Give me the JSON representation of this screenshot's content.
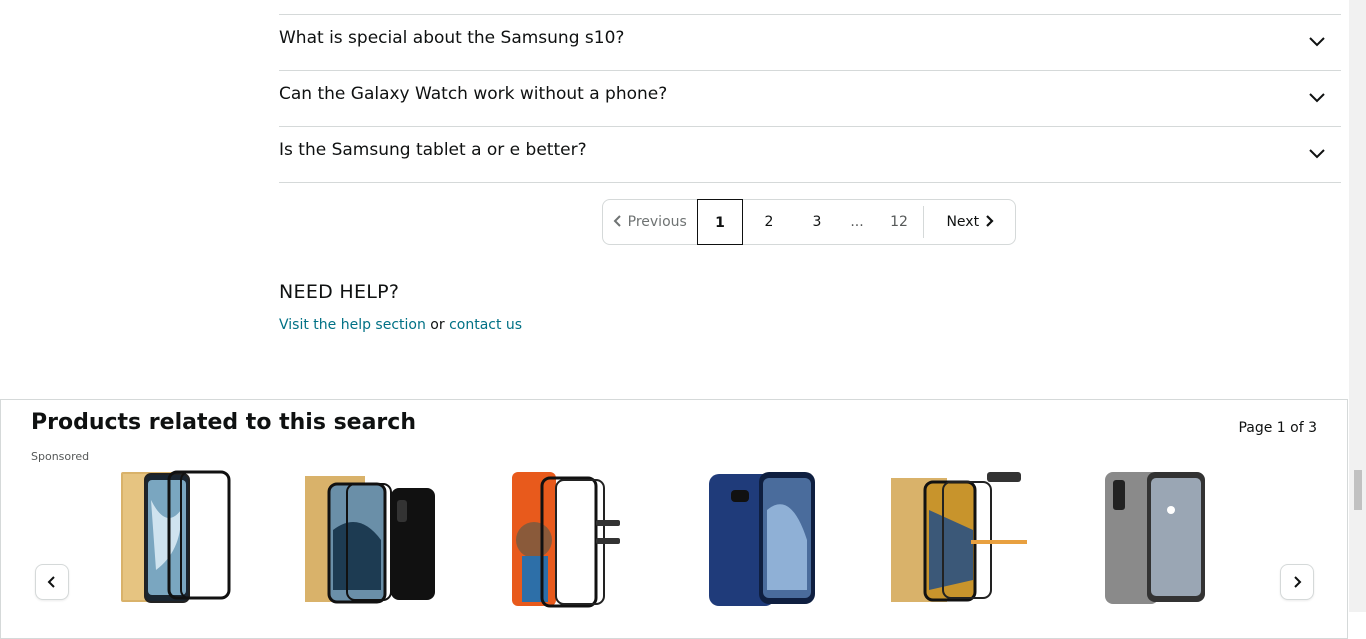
{
  "faq": {
    "items": [
      {
        "question": "What is special about the Samsung s10?"
      },
      {
        "question": "Can the Galaxy Watch work without a phone?"
      },
      {
        "question": "Is the Samsung tablet a or e better?"
      }
    ]
  },
  "pagination": {
    "previous_label": "Previous",
    "pages": [
      "1",
      "2",
      "3"
    ],
    "ellipsis": "...",
    "last_page": "12",
    "next_label": "Next",
    "current": "1"
  },
  "help": {
    "title": "NEED HELP?",
    "link1": "Visit the help section",
    "connector": " or ",
    "link2": "contact us"
  },
  "carousel": {
    "title": "Products related to this search",
    "page_indicator": "Page 1 of 3",
    "sponsored_label": "Sponsored",
    "products": [
      {
        "image": "tempered-glass-screen-protector-product-image"
      },
      {
        "image": "glass-screen-protector-with-phone-product-image"
      },
      {
        "image": "s10-plus-screen-protector-product-image"
      },
      {
        "image": "navy-phone-case-product-image"
      },
      {
        "image": "glass-and-camera-lens-protector-product-image"
      },
      {
        "image": "gray-phone-case-product-image"
      }
    ]
  },
  "colors": {
    "link": "#007185",
    "text": "#0f1111",
    "border": "#d5d9d9",
    "muted": "#565959"
  }
}
